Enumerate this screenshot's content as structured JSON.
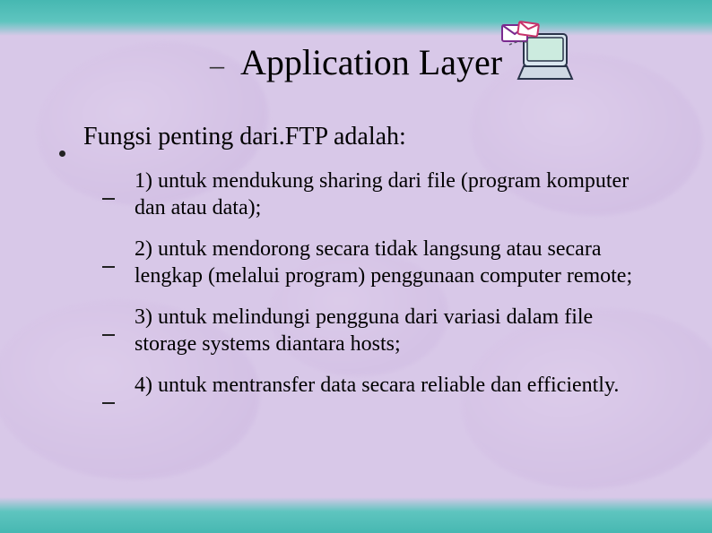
{
  "title": "Application Layer",
  "main_point": "Fungsi penting dari.FTP adalah:",
  "sub_points": [
    "1)  untuk mendukung sharing dari file (program komputer dan atau data);",
    "2)  untuk mendorong secara tidak langsung atau secara lengkap (melalui program) penggunaan computer remote;",
    "3)  untuk melindungi pengguna dari variasi dalam file storage systems diantara hosts;",
    "4)  untuk mentransfer data secara reliable dan efficiently."
  ]
}
